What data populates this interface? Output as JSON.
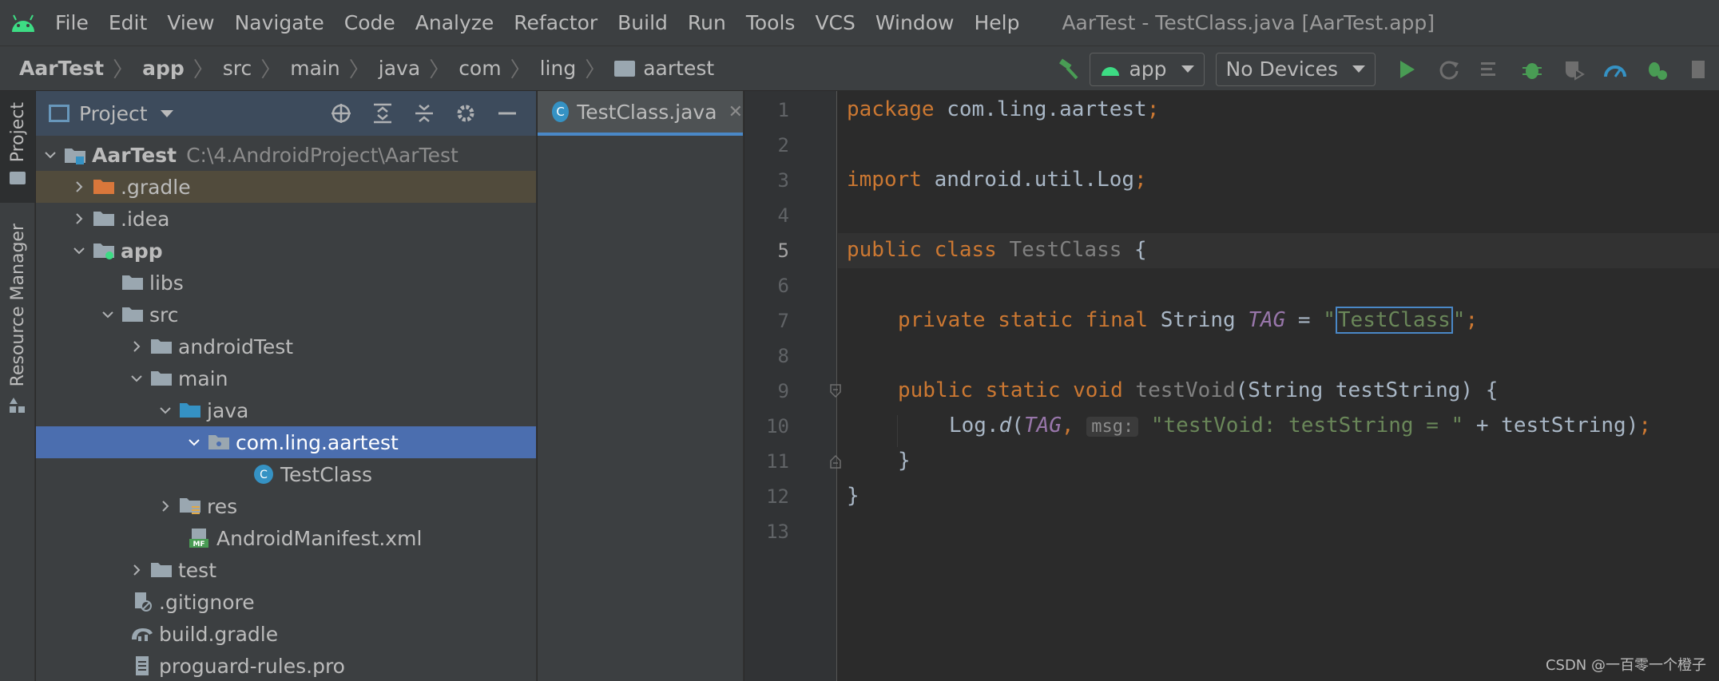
{
  "menubar": {
    "items": [
      "File",
      "Edit",
      "View",
      "Navigate",
      "Code",
      "Analyze",
      "Refactor",
      "Build",
      "Run",
      "Tools",
      "VCS",
      "Window",
      "Help"
    ],
    "window_title": "AarTest - TestClass.java [AarTest.app]"
  },
  "navbar": {
    "breadcrumbs": [
      "AarTest",
      "app",
      "src",
      "main",
      "java",
      "com",
      "ling",
      "aartest"
    ],
    "run_config": "app",
    "device": "No Devices"
  },
  "left_strip": {
    "project_tab": "Project",
    "resource_tab": "Resource Manager"
  },
  "project_panel": {
    "title": "Project",
    "tree": [
      {
        "label": "AarTest",
        "path": "C:\\4.AndroidProject\\AarTest"
      },
      {
        "label": ".gradle"
      },
      {
        "label": ".idea"
      },
      {
        "label": "app"
      },
      {
        "label": "libs"
      },
      {
        "label": "src"
      },
      {
        "label": "androidTest"
      },
      {
        "label": "main"
      },
      {
        "label": "java"
      },
      {
        "label": "com.ling.aartest"
      },
      {
        "label": "TestClass"
      },
      {
        "label": "res"
      },
      {
        "label": "AndroidManifest.xml"
      },
      {
        "label": "test"
      },
      {
        "label": ".gitignore"
      },
      {
        "label": "build.gradle"
      },
      {
        "label": "proguard-rules.pro"
      }
    ]
  },
  "editor": {
    "tab_label": "TestClass.java",
    "tab_icon_letter": "C",
    "line_numbers": [
      "1",
      "2",
      "3",
      "4",
      "5",
      "6",
      "7",
      "8",
      "9",
      "10",
      "11",
      "12",
      "13"
    ],
    "current_line": "5",
    "code": {
      "l1_kw": "package",
      "l1_rest": " com.ling.aartest",
      "l1_semi": ";",
      "l3_kw": "import",
      "l3_rest": " android.util.Log",
      "l3_semi": ";",
      "l5_kw": "public class",
      "l5_name": " TestClass",
      "l5_brace": " {",
      "l7_kw": "private static final",
      "l7_type": " String ",
      "l7_field": "TAG",
      "l7_eq": " = ",
      "l7_q1": "\"",
      "l7_val": "TestClass",
      "l7_q2": "\"",
      "l7_semi": ";",
      "l9_kw": "public static void",
      "l9_name": " testVoid",
      "l9_params": "(String testString) {",
      "l10_log": "Log.",
      "l10_d": "d",
      "l10_open": "(",
      "l10_tag": "TAG",
      "l10_comma": ", ",
      "l10_hint": "msg:",
      "l10_str": "\"testVoid: testString = \"",
      "l10_tail": " + testString)",
      "l10_semi": ";",
      "l11": "}",
      "l12": "}"
    }
  },
  "watermark": "CSDN @一百零一个橙子",
  "colors": {
    "background": "#2b2b2b",
    "panel": "#3c3f41",
    "selection": "#4b6eaf",
    "keyword": "#cc7832",
    "string": "#6a8759",
    "field": "#9876aa",
    "run_green": "#499c54"
  }
}
